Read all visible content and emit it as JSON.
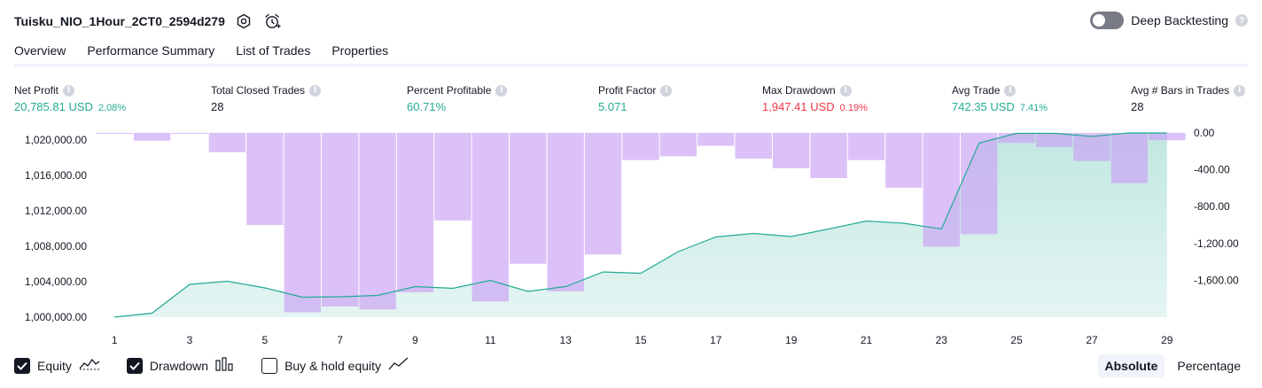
{
  "header": {
    "strategy_name": "Tuisku_NIO_1Hour_2CT0_2594d279",
    "settings_icon": "settings-hex-icon",
    "alert_icon": "alarm-clock-plus-icon",
    "deep_backtesting_label": "Deep Backtesting",
    "deep_backtesting_on": false
  },
  "tabs": [
    {
      "label": "Overview",
      "active": true
    },
    {
      "label": "Performance Summary",
      "active": false
    },
    {
      "label": "List of Trades",
      "active": false
    },
    {
      "label": "Properties",
      "active": false
    }
  ],
  "metrics": {
    "net_profit": {
      "label": "Net Profit",
      "value": "20,785.81 USD",
      "pct": "2.08%"
    },
    "total_closed_trades": {
      "label": "Total Closed Trades",
      "value": "28"
    },
    "percent_profitable": {
      "label": "Percent Profitable",
      "value": "60.71%"
    },
    "profit_factor": {
      "label": "Profit Factor",
      "value": "5.071"
    },
    "max_drawdown": {
      "label": "Max Drawdown",
      "value": "1,947.41 USD",
      "pct": "0.19%"
    },
    "avg_trade": {
      "label": "Avg Trade",
      "value": "742.35 USD",
      "pct": "7.41%"
    },
    "avg_bars": {
      "label": "Avg # Bars in Trades",
      "value": "28"
    }
  },
  "colors": {
    "positive": "#22ab94",
    "negative": "#f23645",
    "equity_line": "#22ab94",
    "drawdown_bar": "#c9a0f5"
  },
  "chart_data": {
    "type": "line",
    "x": [
      1,
      2,
      3,
      4,
      5,
      6,
      7,
      8,
      9,
      10,
      11,
      12,
      13,
      14,
      15,
      16,
      17,
      18,
      19,
      20,
      21,
      22,
      23,
      24,
      25,
      26,
      27,
      28,
      29
    ],
    "x_tick_labels": [
      "1",
      "3",
      "5",
      "7",
      "9",
      "11",
      "13",
      "15",
      "17",
      "19",
      "21",
      "23",
      "25",
      "27",
      "29"
    ],
    "left_axis": {
      "ticks": [
        1000000,
        1004000,
        1008000,
        1012000,
        1016000,
        1020000
      ],
      "tick_labels": [
        "1,000,000.00",
        "1,004,000.00",
        "1,008,000.00",
        "1,012,000.00",
        "1,016,000.00",
        "1,020,000.00"
      ],
      "ylim": [
        1000000,
        1020800
      ]
    },
    "right_axis": {
      "ticks": [
        0,
        -400,
        -800,
        -1200,
        -1600
      ],
      "tick_labels": [
        "0.00",
        "-400.00",
        "-800.00",
        "-1,200.00",
        "-1,600.00"
      ],
      "ylim": [
        -2000,
        0
      ]
    },
    "series": [
      {
        "name": "Equity",
        "axis": "left",
        "values": [
          1000000,
          1000450,
          1003700,
          1004050,
          1003300,
          1002250,
          1002300,
          1002450,
          1003450,
          1003250,
          1004150,
          1002900,
          1003450,
          1005100,
          1004950,
          1007400,
          1009050,
          1009450,
          1009100,
          1009950,
          1010850,
          1010600,
          1009950,
          1019650,
          1020750,
          1020750,
          1020400,
          1020800,
          1020785.81
        ]
      },
      {
        "name": "Drawdown",
        "axis": "right",
        "values": [
          0,
          -85,
          -5,
          -210,
          -1000,
          -1947,
          -1885,
          -1915,
          -1730,
          -950,
          -1830,
          -1420,
          -1720,
          -1320,
          -295,
          -255,
          -140,
          -280,
          -385,
          -490,
          -295,
          -595,
          -1235,
          -1100,
          -110,
          -155,
          -305,
          -545,
          -80
        ]
      }
    ]
  },
  "legend": {
    "equity": {
      "label": "Equity",
      "checked": true,
      "icon": "equity-line-icon"
    },
    "drawdown": {
      "label": "Drawdown",
      "checked": true,
      "icon": "bars-icon"
    },
    "buy_hold": {
      "label": "Buy & hold equity",
      "checked": false,
      "icon": "trend-line-icon"
    }
  },
  "modes": {
    "absolute": "Absolute",
    "percentage": "Percentage",
    "selected": "Absolute"
  }
}
